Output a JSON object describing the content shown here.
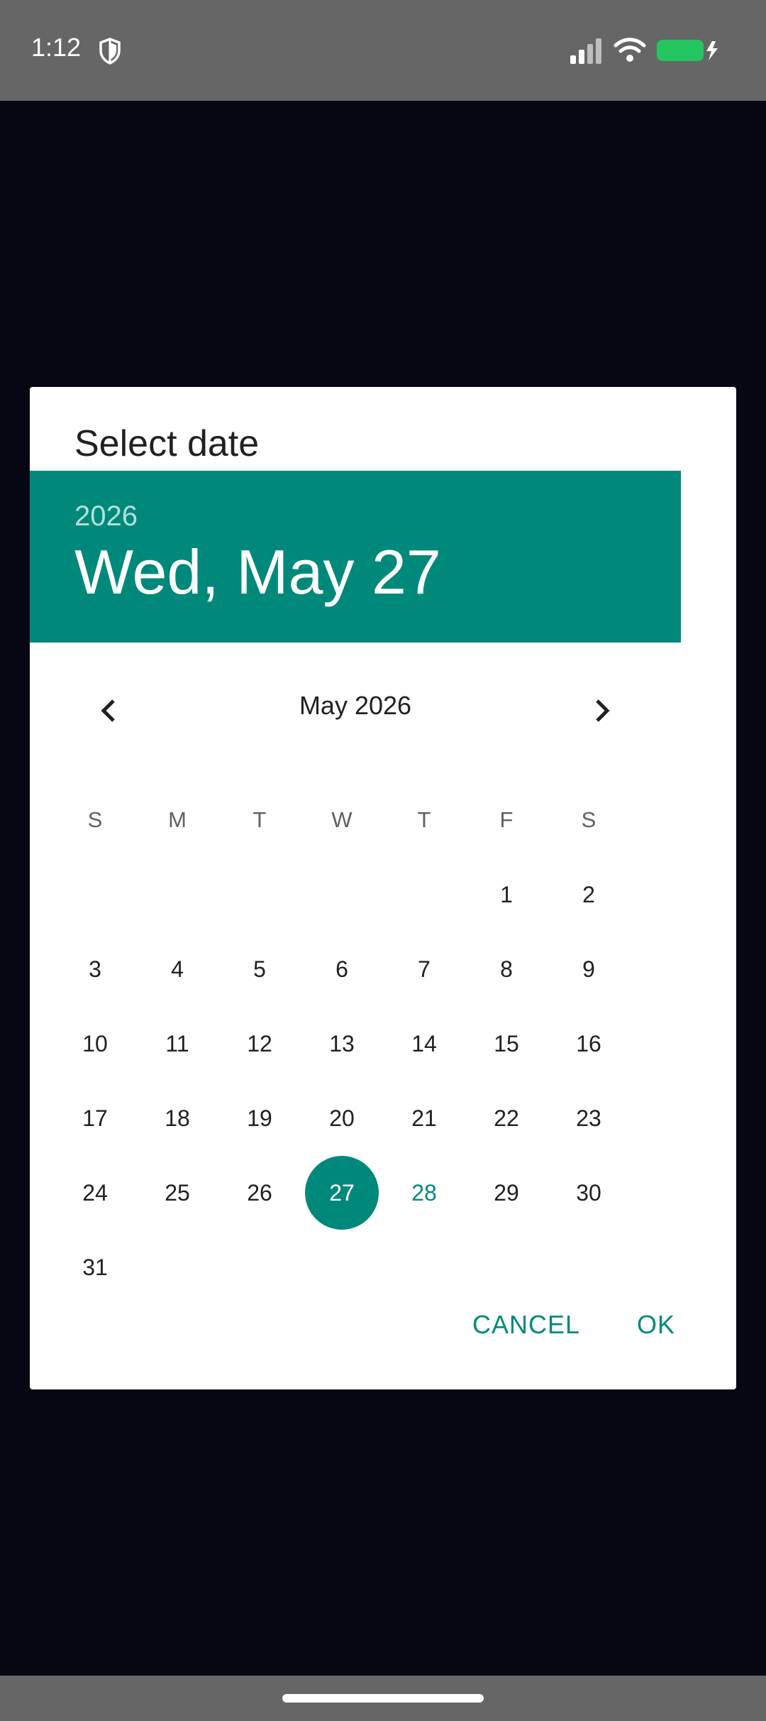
{
  "status_bar": {
    "time": "1:12",
    "battery_color": "#22c55e"
  },
  "dialog": {
    "title": "Select date",
    "header": {
      "year": "2026",
      "date": "Wed, May 27",
      "background": "#00897b"
    },
    "month_label": "May 2026",
    "weekdays": [
      "S",
      "M",
      "T",
      "W",
      "T",
      "F",
      "S"
    ],
    "weeks": [
      [
        "",
        "",
        "",
        "",
        "",
        "1",
        "2"
      ],
      [
        "3",
        "4",
        "5",
        "6",
        "7",
        "8",
        "9"
      ],
      [
        "10",
        "11",
        "12",
        "13",
        "14",
        "15",
        "16"
      ],
      [
        "17",
        "18",
        "19",
        "20",
        "21",
        "22",
        "23"
      ],
      [
        "24",
        "25",
        "26",
        "27",
        "28",
        "29",
        "30"
      ],
      [
        "31",
        "",
        "",
        "",
        "",
        "",
        ""
      ]
    ],
    "selected_day": "27",
    "today": "28",
    "cancel_label": "CANCEL",
    "ok_label": "OK"
  }
}
